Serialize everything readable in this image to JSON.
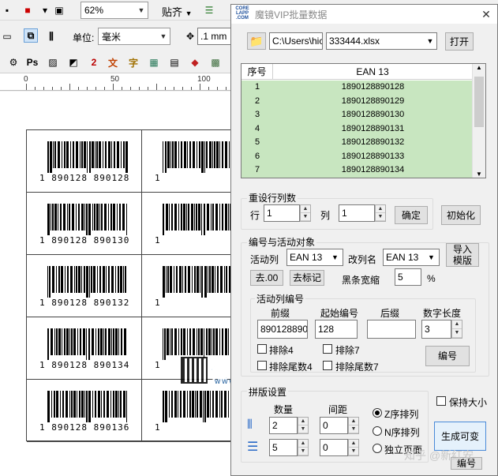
{
  "app": {
    "zoom": "62%",
    "snap_label": "贴齐",
    "unit_label": "单位:",
    "unit_value": "毫米",
    "nudge_value": ".1 mm",
    "ruler_labels": [
      "0",
      "50",
      "100"
    ],
    "toolbar_icons": [
      "Ps",
      "文",
      "字",
      "2"
    ]
  },
  "labels": [
    {
      "left": "1 890128 890128",
      "right": "1"
    },
    {
      "left": "1 890128 890130",
      "right": "1"
    },
    {
      "left": "1 890128 890132",
      "right": "1"
    },
    {
      "left": "1 890128 890134",
      "right": "1"
    },
    {
      "left": "1 890128 890136",
      "right": "1"
    }
  ],
  "watermark": {
    "brand": "亿码元素",
    "url": "www.epinv.com",
    "zhihu": "知乎 @新红安"
  },
  "dialog": {
    "logo": "CORE LAPP .COM",
    "title": "魔镜VIP批量数据",
    "close": "✕",
    "path": "C:\\Users\\hic",
    "file": "333444.xlsx",
    "open_btn": "打开",
    "table": {
      "headers": [
        "序号",
        "EAN 13"
      ],
      "rows": [
        [
          "1",
          "1890128890128"
        ],
        [
          "2",
          "1890128890129"
        ],
        [
          "3",
          "1890128890130"
        ],
        [
          "4",
          "1890128890131"
        ],
        [
          "5",
          "1890128890132"
        ],
        [
          "6",
          "1890128890133"
        ],
        [
          "7",
          "1890128890134"
        ]
      ]
    },
    "reset": {
      "title": "重设行列数",
      "row_label": "行",
      "row_value": "1",
      "col_label": "列",
      "col_value": "1",
      "ok_btn": "确定",
      "init_btn": "初始化"
    },
    "coding": {
      "title": "编号与活动对象",
      "active_col_label": "活动列",
      "active_col_value": "EAN 13",
      "rename_label": "改列名",
      "rename_value": "EAN 13",
      "import_btn": "导入\n模版",
      "strip00_btn": "去.00",
      "unmark_btn": "去标记",
      "shrink_label": "黑条宽缩",
      "shrink_value": "5",
      "shrink_unit": "%"
    },
    "numbering": {
      "title": "活动列编号",
      "prefix_label": "前缀",
      "prefix_value": "890128890",
      "start_label": "起始编号",
      "start_value": "128",
      "suffix_label": "后缀",
      "suffix_value": "",
      "digits_label": "数字长度",
      "digits_value": "3",
      "excl4": "排除4",
      "excl7": "排除7",
      "excl_tail4": "排除尾数4",
      "excl_tail7": "排除尾数7",
      "number_btn": "编号"
    },
    "layout": {
      "title": "拼版设置",
      "count_label": "数量",
      "gap_label": "间距",
      "cols_count": "2",
      "cols_gap": "0",
      "rows_count": "5",
      "rows_gap": "0",
      "z_order": "Z序排列",
      "n_order": "N序排列",
      "single_page": "独立页面",
      "keep_size": "保持大小",
      "generate_btn": "生成可变",
      "number_btn2": "编号"
    }
  },
  "colors": {
    "row_bg": "#c8e6c0",
    "brand_blue": "#1a78c8"
  }
}
